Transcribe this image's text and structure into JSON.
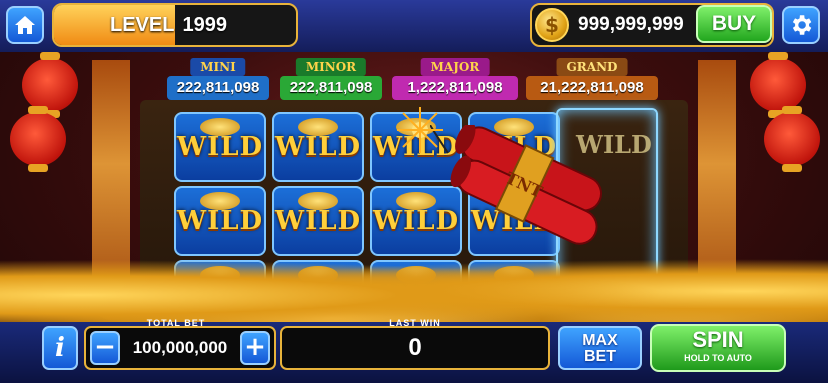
{
  "header": {
    "level_label": "LEVEL",
    "level_value": "1999",
    "level_progress": 0.5,
    "coins": "999,999,999",
    "coin_symbol": "$",
    "buy_label": "BUY"
  },
  "jackpots": [
    {
      "label": "MINI",
      "value": "222,811,098",
      "label_color": "#ffd34a",
      "label_bg": "#1a4aa8",
      "value_bg": "#1f6fc8"
    },
    {
      "label": "MINOR",
      "value": "222,811,098",
      "label_color": "#ffd34a",
      "label_bg": "#1a7a2a",
      "value_bg": "#2aa836"
    },
    {
      "label": "MAJOR",
      "value": "1,222,811,098",
      "label_color": "#ffd34a",
      "label_bg": "#9a1a8a",
      "value_bg": "#c02ab0"
    },
    {
      "label": "GRAND",
      "value": "21,222,811,098",
      "label_color": "#ffe27a",
      "label_bg": "#8a4a14",
      "value_bg": "#b85a12"
    }
  ],
  "reels": {
    "symbol": "WILD",
    "tnt_label": "TNT"
  },
  "footer": {
    "total_bet_label": "TOTAL BET",
    "total_bet_value": "100,000,000",
    "last_win_label": "LAST WIN",
    "last_win_value": "0",
    "max_bet_line1": "MAX",
    "max_bet_line2": "BET",
    "spin_label": "SPIN",
    "spin_sub_label": "HOLD TO AUTO",
    "info_label": "i",
    "minus_label": "−",
    "plus_label": "+"
  },
  "colors": {
    "accent_gold": "#e8b33b",
    "button_blue": "#1458d6",
    "button_green": "#22a61e"
  }
}
